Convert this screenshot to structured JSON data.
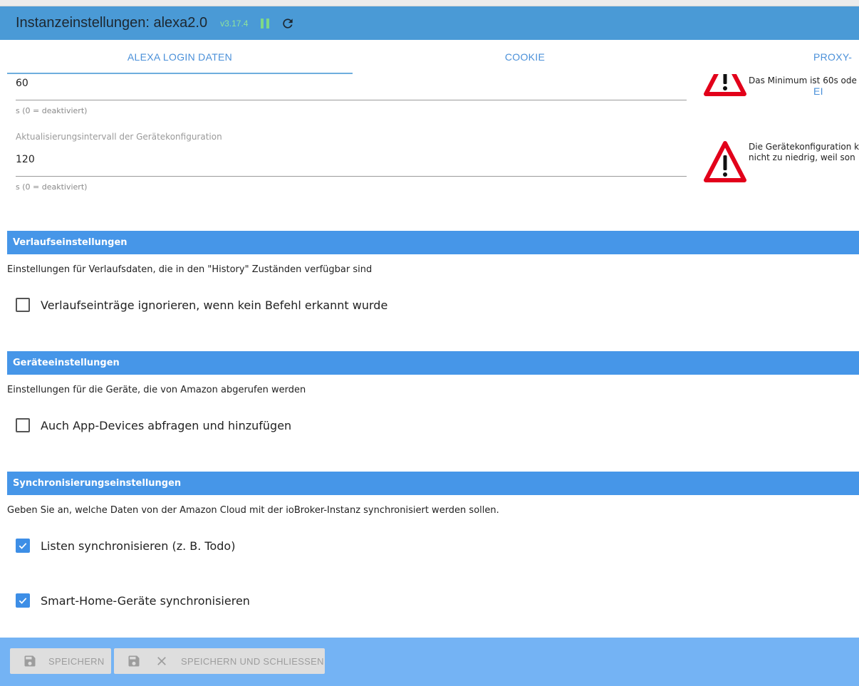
{
  "window": {
    "title": "Instanzeinstellungen: alexa2.0",
    "version": "v3.17.4"
  },
  "tabs": [
    {
      "label": "ALEXA LOGIN DATEN",
      "active": true
    },
    {
      "label": "COOKIE",
      "active": false
    },
    {
      "label": "PROXY-EI",
      "active": false
    }
  ],
  "fields": {
    "interval1": {
      "value": "60",
      "help": "s (0 = deaktiviert)"
    },
    "interval2": {
      "label": "Aktualisierungsintervall der Gerätekonfiguration",
      "value": "120",
      "help": "s (0 = deaktiviert)"
    }
  },
  "warnings": {
    "w1": {
      "line1": "Das Minimum ist 60s ode"
    },
    "w2": {
      "line1": "Die Gerätekonfiguration k",
      "line2": "nicht zu niedrig, weil son"
    }
  },
  "sections": {
    "history": {
      "title": "Verlaufseinstellungen",
      "desc": "Einstellungen für Verlaufsdaten, die in den \"History\" Zuständen verfügbar sind",
      "checkbox": {
        "label": "Verlaufseinträge ignorieren, wenn kein Befehl erkannt wurde",
        "checked": false
      }
    },
    "devices": {
      "title": "Geräteeinstellungen",
      "desc": "Einstellungen für die Geräte, die von Amazon abgerufen werden",
      "checkbox": {
        "label": "Auch App-Devices abfragen und hinzufügen",
        "checked": false
      }
    },
    "sync": {
      "title": "Synchronisierungseinstellungen",
      "desc": "Geben Sie an, welche Daten von der Amazon Cloud mit der ioBroker-Instanz synchronisiert werden sollen.",
      "checkbox_lists": {
        "label": "Listen synchronisieren (z. B. Todo)",
        "checked": true
      },
      "checkbox_smarthome": {
        "label": "Smart-Home-Geräte synchronisieren",
        "checked": true
      }
    }
  },
  "footer": {
    "save_label": "SPEICHERN",
    "save_close_label": "SPEICHERN UND SCHLIESSEN"
  },
  "colors": {
    "titlebar": "#4a9ad6",
    "section_bar": "#4696e8",
    "footer": "#74b3f4",
    "checkbox_checked": "#3d8ee6",
    "warning_red": "#e2001a"
  }
}
